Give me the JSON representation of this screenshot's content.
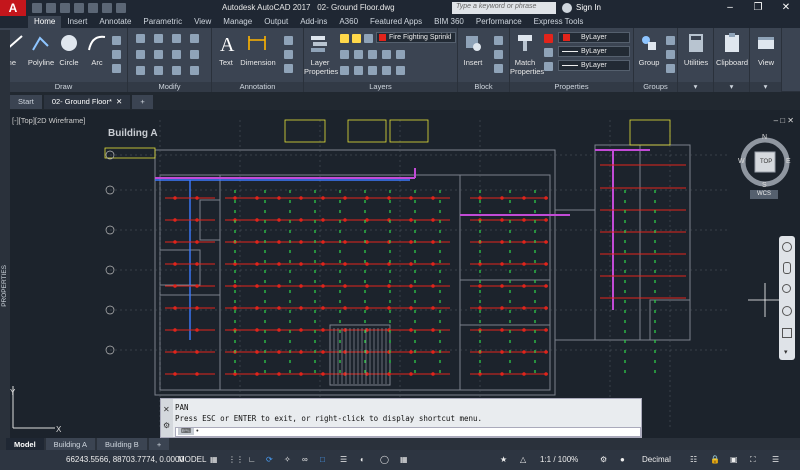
{
  "window": {
    "app_title": "Autodesk AutoCAD 2017",
    "file_title": "02- Ground Floor.dwg",
    "search_placeholder": "Type a keyword or phrase",
    "sign_in": "Sign In"
  },
  "ribbon_tabs": [
    "Home",
    "Insert",
    "Annotate",
    "Parametric",
    "View",
    "Manage",
    "Output",
    "Add-ins",
    "A360",
    "Featured Apps",
    "BIM 360",
    "Performance",
    "Express Tools"
  ],
  "ribbon": {
    "draw": {
      "title": "Draw",
      "buttons": [
        "ine",
        "Polyline",
        "Circle",
        "Arc"
      ]
    },
    "modify": {
      "title": "Modify"
    },
    "annotation": {
      "title": "Annotation",
      "buttons": [
        "Text",
        "Dimension"
      ]
    },
    "layers": {
      "title": "Layers",
      "layer_properties": "Layer Properties",
      "current_layer": "Fire Fighting Sprinkl"
    },
    "block": {
      "title": "Block",
      "insert": "Insert"
    },
    "properties": {
      "title": "Properties",
      "match": "Match Properties",
      "color": "ByLayer",
      "linetype": "ByLayer",
      "lineweight": "ByLayer"
    },
    "groups": {
      "title": "Groups",
      "group": "Group"
    },
    "utilities": "Utilities",
    "clipboard": "Clipboard",
    "view": "View"
  },
  "file_tabs": [
    "Start",
    "02- Ground Floor*"
  ],
  "viewport": {
    "label": "[-][Top][2D Wireframe]",
    "building_label": "Building A",
    "viewcube": {
      "n": "N",
      "s": "S",
      "e": "E",
      "w": "W",
      "top": "TOP",
      "wcs": "WCS"
    }
  },
  "side_palette": "PROPERTIES",
  "command": {
    "line1": "PAN",
    "line2": "Press ESC or ENTER to exit, or right-click to display shortcut menu.",
    "prompt": "•"
  },
  "layout_tabs": [
    "Model",
    "Building A",
    "Building B"
  ],
  "status": {
    "coordinates": "66243.5566, 88703.7774, 0.0000",
    "space": "MODEL",
    "scale": "1:1 / 100%",
    "units": "Decimal"
  },
  "colors": {
    "accent": "#c4161c",
    "background": "#1c232c",
    "ribbon": "#3b4452"
  }
}
